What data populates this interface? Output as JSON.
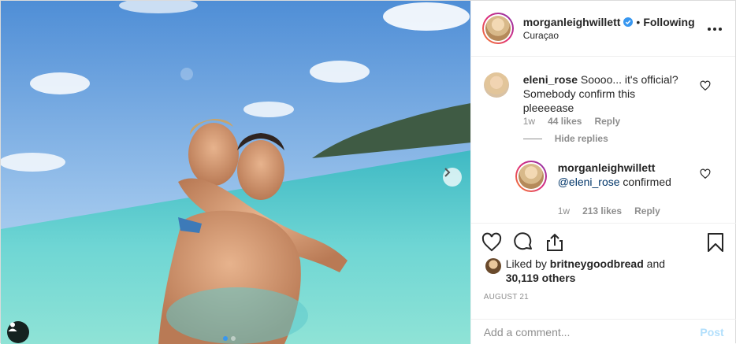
{
  "post": {
    "username": "morganleighwillett",
    "following_label": "Following",
    "location": "Curaçao",
    "date": "AUGUST 21",
    "likes": {
      "liked_by_prefix": "Liked by",
      "liked_by_user": "britneygoodbread",
      "and": "and",
      "others": "30,119 others"
    }
  },
  "comments": [
    {
      "username": "eleni_rose",
      "text": "Soooo... it's official? Somebody confirm this pleeeease",
      "age": "1w",
      "likes": "44 likes",
      "reply": "Reply"
    },
    {
      "username": "morganleighwillett",
      "mention": "@eleni_rose",
      "text": "confirmed",
      "age": "1w",
      "likes": "213 likes",
      "reply": "Reply"
    }
  ],
  "hide_replies": "Hide replies",
  "composer": {
    "placeholder": "Add a comment...",
    "post_label": "Post"
  },
  "icons": [
    "verified-badge-icon",
    "more-options-icon",
    "heart-icon",
    "comment-icon",
    "share-icon",
    "bookmark-icon",
    "chevron-right-icon",
    "user-tag-icon"
  ],
  "colors": {
    "verified": "#3897f0",
    "mention": "#003569",
    "post_button_disabled": "#b2dffc",
    "meta_text": "#8e8e8e"
  },
  "carousel": {
    "slide_count": 2,
    "active_slide": 1
  }
}
